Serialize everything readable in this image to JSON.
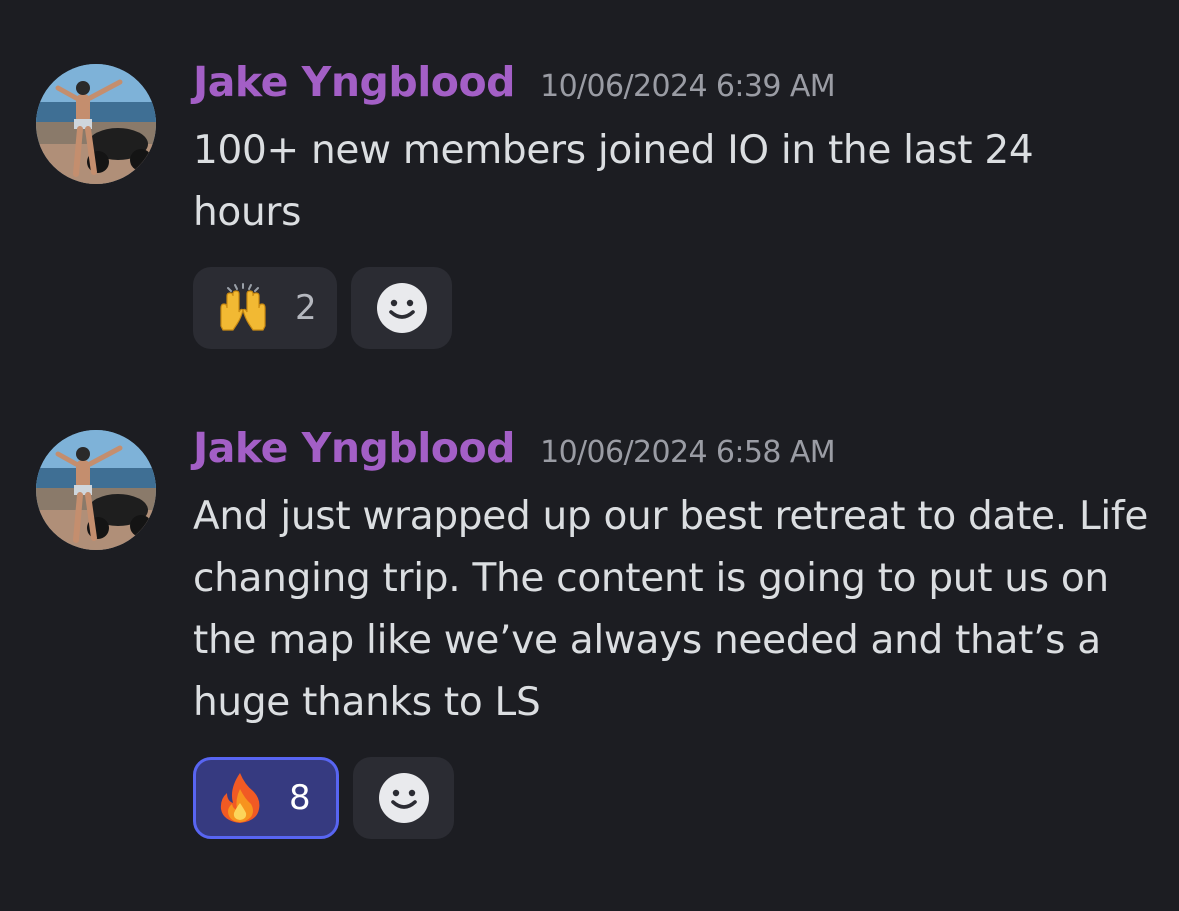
{
  "messages": [
    {
      "author": "Jake Yngblood",
      "timestamp": "10/06/2024 6:39 AM",
      "content": "100+ new members joined IO in the last 24 hours",
      "reactions": [
        {
          "emoji": "raising-hands",
          "count": "2",
          "active": false
        }
      ],
      "author_color": "#a35fc6"
    },
    {
      "author": "Jake Yngblood",
      "timestamp": "10/06/2024 6:58 AM",
      "content": "And just wrapped up our best retreat to date. Life changing trip. The content is going to put us on the map like we’ve always needed and that’s a huge thanks to LS",
      "reactions": [
        {
          "emoji": "fire",
          "count": "8",
          "active": true
        }
      ],
      "author_color": "#a35fc6"
    }
  ],
  "colors": {
    "background": "#1c1d22",
    "reaction_active_border": "#5865f2",
    "reaction_active_bg": "#363a80"
  }
}
